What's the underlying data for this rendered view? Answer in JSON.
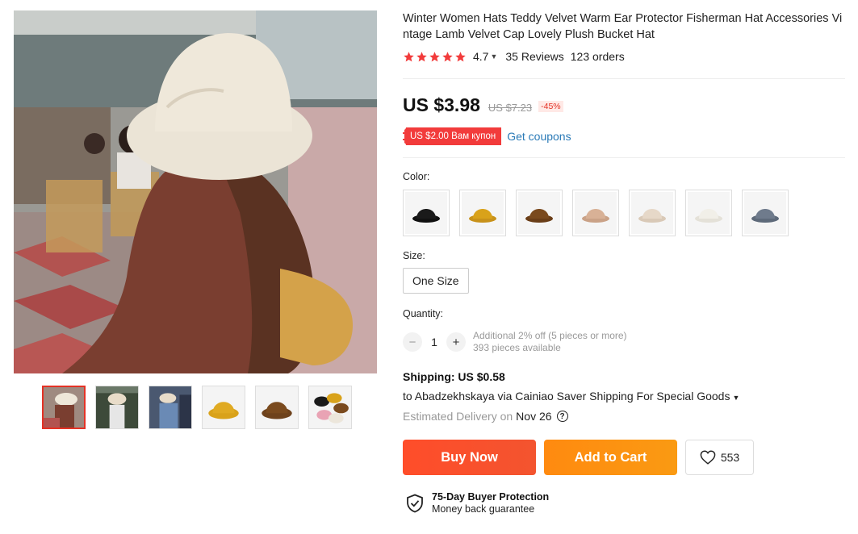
{
  "product": {
    "title": "Winter Women Hats Teddy Velvet Warm Ear Protector Fisherman Hat Accessories Vintage Lamb Velvet Cap Lovely Plush Bucket Hat",
    "rating": "4.7",
    "rating_stars": 5,
    "reviews": "35 Reviews",
    "orders": "123 orders"
  },
  "price": {
    "current": "US $3.98",
    "original": "US $7.23",
    "discount": "-45%"
  },
  "coupon": {
    "badge": "US $2.00 Вам купон",
    "link": "Get coupons"
  },
  "color": {
    "label": "Color:",
    "options": [
      {
        "name": "black",
        "hex": "#1a1a1a"
      },
      {
        "name": "yellow",
        "hex": "#d9a21a"
      },
      {
        "name": "brown",
        "hex": "#7a4a1e"
      },
      {
        "name": "camel",
        "hex": "#d8b196"
      },
      {
        "name": "beige",
        "hex": "#e6d8c8"
      },
      {
        "name": "white",
        "hex": "#f1efe8"
      },
      {
        "name": "gray",
        "hex": "#6f7b8c"
      }
    ]
  },
  "size": {
    "label": "Size:",
    "selected": "One Size"
  },
  "quantity": {
    "label": "Quantity:",
    "minus": "−",
    "value": "1",
    "plus": "+",
    "discount_note": "Additional 2% off (5 pieces or more)",
    "available": "393 pieces available"
  },
  "shipping": {
    "title": "Shipping: US $0.58",
    "to": "to Abadzekhskaya via Cainiao Saver Shipping For Special Goods",
    "estimated_label": "Estimated Delivery on",
    "estimated_date": "Nov 26",
    "help_icon": "?"
  },
  "actions": {
    "buy_now": "Buy Now",
    "add_to_cart": "Add to Cart",
    "wishlist_count": "553"
  },
  "protection": {
    "title": "75-Day Buyer Protection",
    "subtitle": "Money back guarantee"
  },
  "gallery": {
    "thumbnail_count": 6,
    "active_index": 0
  },
  "colors": {
    "accent_red": "#e43225",
    "buy_now": "#ff4d2a",
    "add_to_cart": "#ff8a10",
    "star": "#f23b3b",
    "link": "#2a7ab7"
  }
}
